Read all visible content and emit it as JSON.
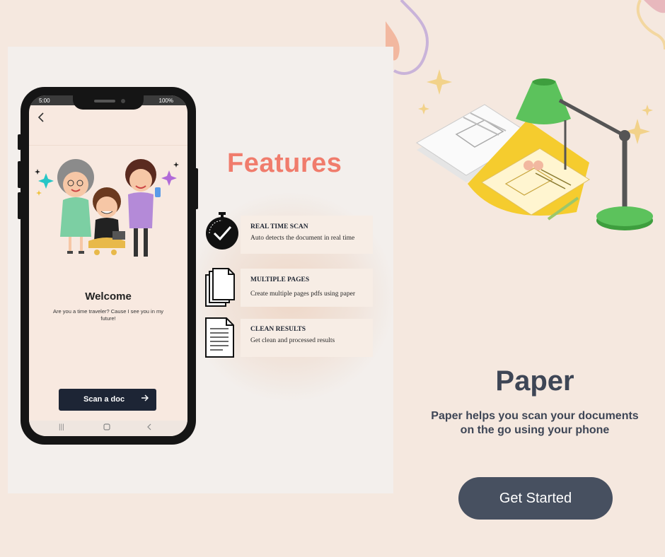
{
  "phone": {
    "status_time": "5:00",
    "status_battery": "100%",
    "back_icon": "chevron-left-icon",
    "welcome_title": "Welcome",
    "welcome_text": "Are you a time traveler? Cause I see you in my future!",
    "scan_button_label": "Scan a doc",
    "scan_button_icon": "arrow-right-icon",
    "nav": {
      "recents_icon": "recents-icon",
      "home_icon": "home-icon",
      "back_icon": "back-icon"
    }
  },
  "features": {
    "heading": "Features",
    "items": [
      {
        "title": "REAL TIME SCAN",
        "description": "Auto detects the document in real time",
        "icon": "stopwatch-icon"
      },
      {
        "title": "MULTIPLE PAGES",
        "description": "Create multiple pages pdfs using paper",
        "icon": "multiple-pages-icon"
      },
      {
        "title": "CLEAN RESULTS",
        "description": "Get  clean and processed results",
        "icon": "document-icon"
      }
    ]
  },
  "hero": {
    "title": "Paper",
    "description": "Paper helps you scan your documents on the go using your phone",
    "cta_label": "Get Started"
  },
  "colors": {
    "background": "#f5e8df",
    "features_heading": "#f07c6c",
    "dark_button": "#1d2535",
    "cta_button": "#475060",
    "lamp_green": "#5cc25c",
    "light_yellow": "#f5cc2e"
  }
}
